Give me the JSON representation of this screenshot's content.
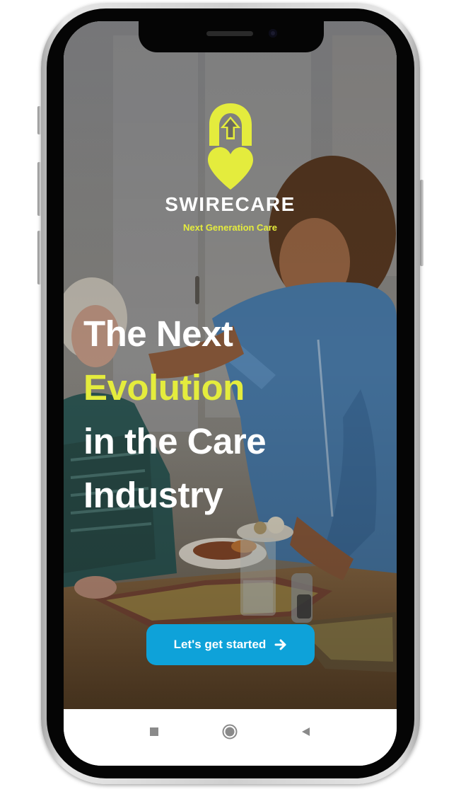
{
  "app": {
    "brand_name": "SWIRECARE",
    "tagline": "Next Generation Care"
  },
  "hero": {
    "line1": "The Next",
    "line2": "Evolution",
    "line3": "in the Care",
    "line4": "Industry"
  },
  "cta": {
    "label": "Let's get started",
    "icon": "arrow-right-icon"
  },
  "system_nav": {
    "items": [
      {
        "name": "recent-apps",
        "icon": "square-icon"
      },
      {
        "name": "home",
        "icon": "circle-icon"
      },
      {
        "name": "back",
        "icon": "triangle-left-icon"
      }
    ]
  },
  "colors": {
    "accent": "#e4ec3d",
    "button": "#0ea2d9",
    "text": "#ffffff",
    "nav_icon": "#8a8a8a"
  }
}
